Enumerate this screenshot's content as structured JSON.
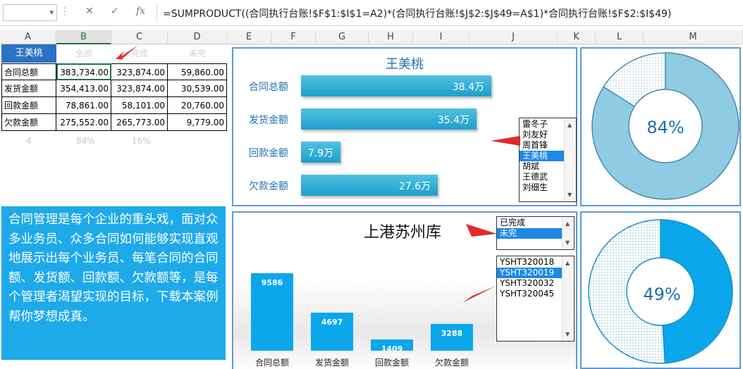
{
  "formula_bar": {
    "formula": "=SUMPRODUCT((合同执行台账!$F$1:$I$1=A2)*(合同执行台账!$J$2:$J$49=A$1)*合同执行台账!$F$2:$I$49)",
    "cancel_glyph": "✕",
    "confirm_glyph": "✓",
    "fx_glyph": "fx"
  },
  "columns": [
    "A",
    "B",
    "C",
    "D",
    "E",
    "F",
    "G",
    "H",
    "I",
    "J",
    "K",
    "L",
    "M"
  ],
  "table": {
    "header": {
      "name": "王美桃",
      "all": "全部",
      "done": "完成",
      "undone": "未完"
    },
    "rows": [
      {
        "label": "合同总额",
        "all": "383,734.00",
        "done": "323,874.00",
        "undone": "59,860.00"
      },
      {
        "label": "发货金额",
        "all": "354,413.00",
        "done": "323,874.00",
        "undone": "30,539.00"
      },
      {
        "label": "回款金额",
        "all": "78,861.00",
        "done": "58,101.00",
        "undone": "20,760.00"
      },
      {
        "label": "欠款金额",
        "all": "275,552.00",
        "done": "265,773.00",
        "undone": "9,779.00"
      }
    ],
    "footer": {
      "a": "4",
      "b": "84%",
      "c": "16%"
    }
  },
  "description": "合同管理是每个企业的重头戏，面对众多业务员、众多合同如何能够实现直观地展示出每个业务员、每笔合同的合同额、发货额、回款额、欠款额等，是每个管理者渴望实现的目标，下载本案例帮你梦想成真。",
  "bar_panel": {
    "title": "王美桃",
    "bars": [
      {
        "label": "合同总额",
        "value": 38.4,
        "text": "38.4万"
      },
      {
        "label": "发货金额",
        "value": 35.4,
        "text": "35.4万"
      },
      {
        "label": "回款金额",
        "value": 7.9,
        "text": "7.9万"
      },
      {
        "label": "欠款金额",
        "value": 27.6,
        "text": "27.6万"
      }
    ]
  },
  "salesperson_list": {
    "items": [
      "雷冬子",
      "刘友好",
      "周首锋",
      "王美桃",
      "胡斌",
      "王德武",
      "刘细生"
    ],
    "selected": "王美桃"
  },
  "donut_top": {
    "label": "84%",
    "value": 84,
    "color": "#8fcbe2"
  },
  "donut_bottom": {
    "label": "49%",
    "value": 49,
    "color": "#0aa7ec"
  },
  "column_panel": {
    "title": "上港苏州库",
    "bars": [
      {
        "label": "合同总额",
        "value": 9586
      },
      {
        "label": "发货金额",
        "value": 4697
      },
      {
        "label": "回款金额",
        "value": 1409
      },
      {
        "label": "欠款金额",
        "value": 3288
      }
    ]
  },
  "status_list": {
    "items": [
      "已完成",
      "未完"
    ],
    "selected": "未完"
  },
  "contract_list": {
    "items": [
      "YSHT320018",
      "YSHT320019",
      "YSHT320032",
      "YSHT320045"
    ],
    "selected": "YSHT320019"
  }
}
